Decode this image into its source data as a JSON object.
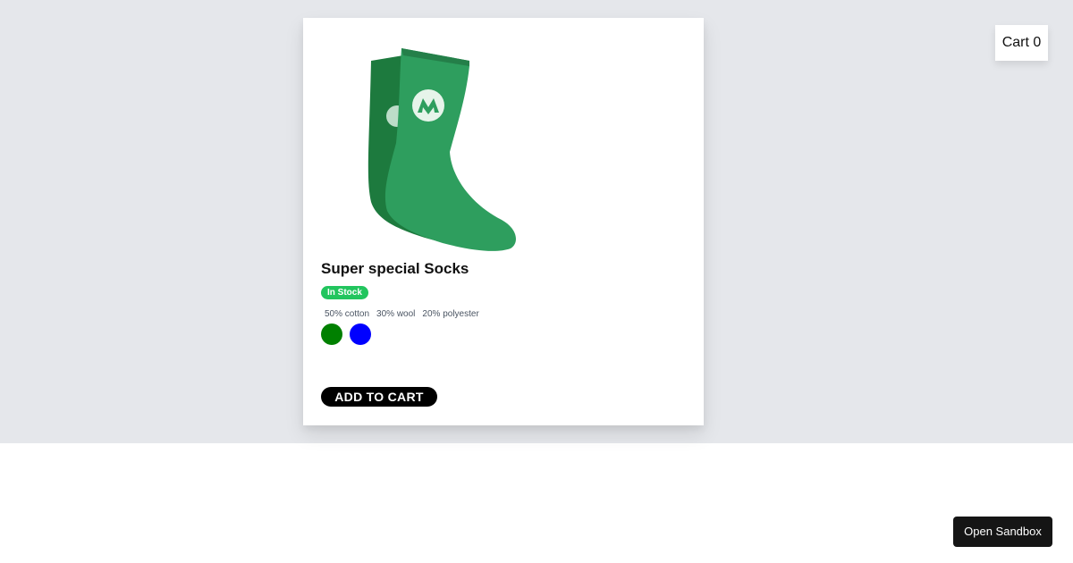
{
  "cart": {
    "label": "Cart",
    "count": "0"
  },
  "product": {
    "image_icon": "green-socks-image",
    "title": "Super special Socks",
    "stock_status": "In Stock",
    "materials": [
      "50% cotton",
      "30% wool",
      "20% polyester"
    ],
    "color_options": [
      "#008000",
      "#0000ff"
    ],
    "add_to_cart_label": "ADD TO CART"
  },
  "sandbox": {
    "label": "Open Sandbox"
  },
  "colors": {
    "page_band": "#e5e7eb",
    "stock_badge": "#22c55e",
    "sock_front": "#2e9e5e",
    "sock_back": "#1d7a3e"
  }
}
